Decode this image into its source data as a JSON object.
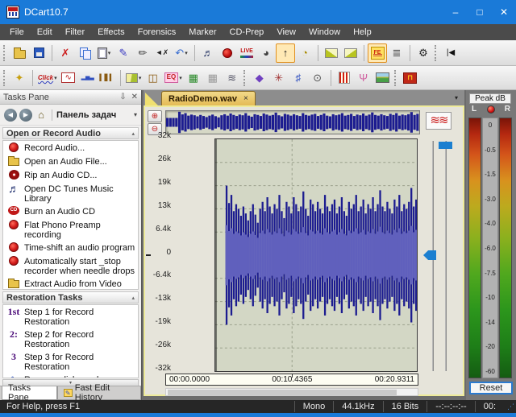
{
  "window": {
    "title": "DCart10.7",
    "controls": {
      "minimize": "–",
      "maximize": "□",
      "close": "✕"
    }
  },
  "ui": {
    "dropdown": "▾",
    "collapse": "▴",
    "scroll_down": "▾",
    "overflow": "▾",
    "tab_close": "×",
    "pin": "⇩",
    "pane_close": "✕",
    "back": "◀",
    "forward": "▶",
    "home": "⌂",
    "zoom_in": "⊕",
    "zoom_out": "⊖",
    "squiggle": "≋≋"
  },
  "menu": {
    "items": [
      "File",
      "Edit",
      "Filter",
      "Effects",
      "Forensics",
      "Marker",
      "CD-Prep",
      "View",
      "Window",
      "Help"
    ]
  },
  "toolbar1": {
    "items": [
      {
        "t": "grip"
      },
      {
        "name": "open-file-button",
        "cls": "tc-folder"
      },
      {
        "name": "save-button",
        "cls": "tc-floppy"
      },
      {
        "t": "sep"
      },
      {
        "name": "delete-button",
        "g": "✗",
        "c": "#cc2020"
      },
      {
        "name": "copy-button",
        "cls": "tc-copy"
      },
      {
        "name": "paste-button",
        "cls": "tc-paste",
        "dd": 1
      },
      {
        "name": "marker-pen-button",
        "g": "✎",
        "c": "#3535c0"
      },
      {
        "name": "pencil-edit-button",
        "g": "✏",
        "c": "#444"
      },
      {
        "name": "mute-speaker-button",
        "g": "◄✗",
        "c": "#222",
        "fs": 9
      },
      {
        "name": "undo-button",
        "g": "↶",
        "c": "#3a6ed0",
        "dd": 1
      },
      {
        "t": "sep"
      },
      {
        "name": "dc-tunes-button",
        "g": "♬",
        "c": "#203060"
      },
      {
        "name": "record-button",
        "cls": "tc-rec"
      },
      {
        "name": "live-mode-button",
        "cls": "tc-live",
        "txt": "LIVE"
      },
      {
        "name": "power-meter-button",
        "g": "◕",
        "c": "#404040"
      },
      {
        "name": "marker-arrows-button",
        "g": "↑",
        "c": "#222",
        "pressed": 1
      },
      {
        "name": "timer-gauge-button",
        "g": "◔",
        "c": "#a88a00"
      },
      {
        "t": "sep"
      },
      {
        "name": "fade-in-button",
        "cls": "tc-fadein"
      },
      {
        "name": "fade-out-button",
        "cls": "tc-fadeout"
      },
      {
        "t": "sep"
      },
      {
        "name": "fast-edit-button",
        "cls": "tc-fe",
        "txt": "FE",
        "pressed": 1
      },
      {
        "name": "center-channel-button",
        "g": "≣",
        "c": "#555"
      },
      {
        "t": "sep"
      },
      {
        "name": "settings-gear-button",
        "g": "⚙",
        "c": "#222"
      },
      {
        "t": "grip"
      },
      {
        "name": "skip-to-start-button",
        "g": "|◀",
        "c": "#111",
        "fs": 10
      }
    ]
  },
  "toolbar2": {
    "items": [
      {
        "t": "grip"
      },
      {
        "name": "sparkle-tool-button",
        "g": "✦",
        "c": "#c8a010"
      },
      {
        "t": "sep"
      },
      {
        "name": "click-filter-button",
        "cls": "tc-click",
        "txt": "Click",
        "dd": 1
      },
      {
        "name": "spectrum-analyzer-button",
        "cls": "tc-box",
        "g": "∿",
        "c": "#c02020"
      },
      {
        "name": "histogram-button",
        "g": "▂▅▃",
        "c": "#3050c0",
        "fs": 7
      },
      {
        "name": "level-bars-button",
        "g": "▍▋▍",
        "c": "#8a5a10",
        "fs": 8
      },
      {
        "t": "sep"
      },
      {
        "name": "fade-tool-button",
        "cls": "tc-fadeshape",
        "dd": 1
      },
      {
        "name": "presets-book-button",
        "g": "◫",
        "c": "#8a5a10"
      },
      {
        "name": "eq-filter-button",
        "cls": "tc-eq",
        "txt": "EQ",
        "dd": 1
      },
      {
        "name": "speaker-grid-button",
        "g": "▦",
        "c": "#2a8a2a"
      },
      {
        "name": "image-disabled-button",
        "g": "▦",
        "c": "#9a9a9a"
      },
      {
        "name": "wind-noise-button",
        "g": "≋",
        "c": "#556"
      },
      {
        "t": "grip"
      },
      {
        "name": "dynamics-diamond-button",
        "g": "◆",
        "c": "#7040c0"
      },
      {
        "name": "noise-filter-button",
        "g": "✳",
        "c": "#a03030"
      },
      {
        "name": "node-editor-button",
        "g": "♯",
        "c": "#3050c0"
      },
      {
        "name": "monitor-speaker-button",
        "g": "⊙",
        "c": "#555"
      },
      {
        "t": "sep"
      },
      {
        "name": "impulse-filter-button",
        "cls": "tc-redstripes"
      },
      {
        "name": "media-blender-button",
        "g": "Ψ",
        "c": "#d060a0"
      },
      {
        "name": "picture-view-button",
        "cls": "tc-pic"
      },
      {
        "t": "grip"
      },
      {
        "name": "signal-generator-button",
        "cls": "tc-sqw",
        "txt": "⊓"
      }
    ]
  },
  "tasks_pane": {
    "title": "Tasks Pane",
    "nav_label": "Панель задач",
    "sections": [
      {
        "title": "Open or Record Audio",
        "items": [
          {
            "icon": "record-dot",
            "label": "Record Audio...",
            "lines": 1
          },
          {
            "icon": "folder-open",
            "label": "Open an Audio File...",
            "lines": 1
          },
          {
            "icon": "disc-red",
            "label": "Rip an Audio CD...",
            "lines": 1
          },
          {
            "icon": "music-notes",
            "glyph": "♬",
            "label": "Open DC Tunes Music Library",
            "lines": 2
          },
          {
            "icon": "cd-badge",
            "glyph": "CD",
            "label": "Burn an Audio CD",
            "lines": 1
          },
          {
            "icon": "record-dot",
            "label": "Flat Phono Preamp recording",
            "lines": 2
          },
          {
            "icon": "record-dot",
            "label": "Time-shift an audio program",
            "lines": 1
          },
          {
            "icon": "record-dot",
            "label": "Automatically start _stop recorder when needle drops",
            "lines": 2
          },
          {
            "icon": "folder-open",
            "label": "Extract Audio from Video",
            "lines": 1
          }
        ]
      },
      {
        "title": "Restoration Tasks",
        "items": [
          {
            "icon": "badge",
            "glyph": "1st",
            "label": "Step 1 for Record Restoration",
            "lines": 2
          },
          {
            "icon": "badge",
            "glyph": "2:",
            "label": "Step 2 for Record Restoration",
            "lines": 2
          },
          {
            "icon": "badge",
            "glyph": "3",
            "label": "Step 3 for Record Restoration",
            "lines": 2
          },
          {
            "icon": "wave-blue",
            "glyph": "∿",
            "label": "Remove clicks and pops",
            "lines": 1
          }
        ]
      }
    ],
    "tabs": [
      {
        "label": "Tasks Pane",
        "active": true
      },
      {
        "label": "Fast Edit History",
        "active": false
      }
    ]
  },
  "document": {
    "tab_label": "RadioDemo.wav",
    "y_labels": [
      "32k",
      "26k",
      "19k",
      "13k",
      "6.4k",
      "0",
      "-6.4k",
      "-13k",
      "-19k",
      "-26k",
      "-32k"
    ],
    "time_labels": [
      "00:00.0000",
      "00:10.4365",
      "00:20.9311"
    ],
    "waveform": {
      "color_dark": "#1c1c90",
      "color_light": "#6060bd",
      "peaks": [
        0,
        0,
        0,
        0,
        0.6,
        0.45,
        0.52,
        0.38,
        0.44,
        0.4,
        0.34,
        0.42,
        0.36,
        0.3,
        0.38,
        0.44,
        0.35,
        0.28,
        0.4,
        0.46,
        0.38,
        0.5,
        0.42,
        0.36,
        0.44,
        0.4,
        0.52,
        0.38,
        0.32,
        0.46,
        0.42,
        0.36,
        0.5,
        0.44,
        0.38,
        0.42,
        0.55,
        0.4,
        0.34,
        0.48,
        0.44,
        0.38,
        0.46,
        0.4,
        0.36,
        0.52,
        0.42,
        0.38,
        0.44,
        0.48,
        0.36,
        0.42,
        0.5,
        0.38,
        0.34,
        0.46,
        0.4,
        0.44,
        0.52,
        0.38,
        0.42,
        0.48,
        0.36,
        0.44,
        0.4,
        0.5,
        0.38,
        0.44,
        0.56,
        0.42,
        0.38,
        0.46,
        0.4,
        0.36,
        0.48,
        0.42,
        0.52,
        0.38,
        0.44,
        0.4,
        0.46,
        0.58,
        0.42,
        0.48
      ]
    }
  },
  "meter": {
    "title": "Peak dB",
    "left_label": "L",
    "right_label": "R",
    "scale": [
      "0",
      "-0.5",
      "-1.5",
      "-3.0",
      "-4.0",
      "-6.0",
      "-7.5",
      "-10",
      "-14",
      "-20",
      "-60"
    ],
    "reset_label": "Reset"
  },
  "status_bar": {
    "help": "For Help, press F1",
    "channels": "Mono",
    "sample_rate": "44.1kHz",
    "bit_depth": "16 Bits",
    "timecode": "--:--:--:--",
    "counter": "00:"
  }
}
